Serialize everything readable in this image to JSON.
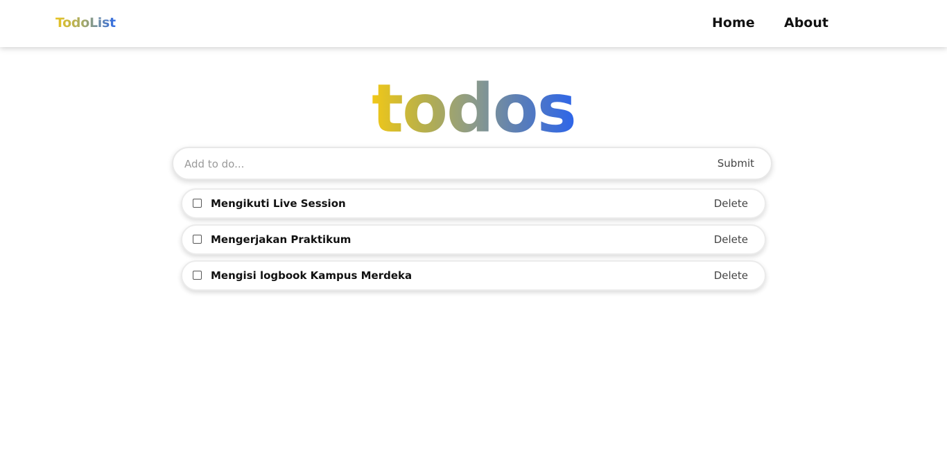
{
  "navbar": {
    "brand": "TodoList",
    "links": [
      {
        "label": "Home"
      },
      {
        "label": "About"
      }
    ]
  },
  "hero": {
    "title": "todos"
  },
  "form": {
    "placeholder": "Add to do...",
    "value": "",
    "submit_label": "Submit"
  },
  "todos": [
    {
      "text": "Mengikuti Live Session",
      "done": false,
      "delete_label": "Delete"
    },
    {
      "text": "Mengerjakan Praktikum",
      "done": false,
      "delete_label": "Delete"
    },
    {
      "text": "Mengisi logbook Kampus Merdeka",
      "done": false,
      "delete_label": "Delete"
    }
  ],
  "colors": {
    "gradient_start": "#f1c817",
    "gradient_end": "#2d65ea",
    "text": "#111111",
    "muted": "#444444"
  }
}
